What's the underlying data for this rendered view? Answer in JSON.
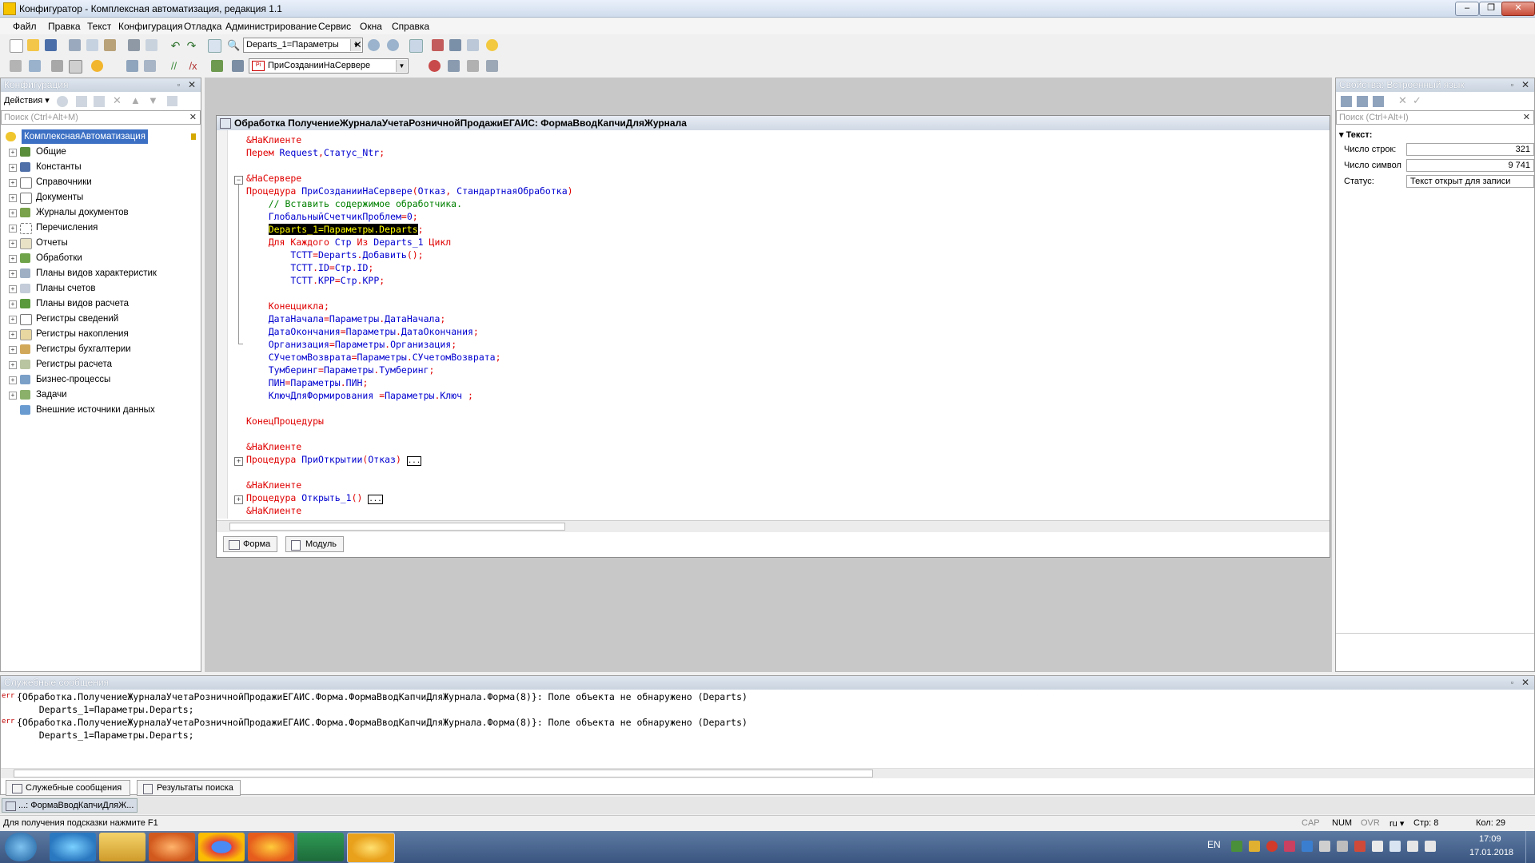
{
  "window": {
    "title": "Конфигуратор - Комплексная автоматизация, редакция 1.1"
  },
  "menu": [
    "Файл",
    "Правка",
    "Текст",
    "Конфигурация",
    "Отладка",
    "Администрирование",
    "Сервис",
    "Окна",
    "Справка"
  ],
  "toolbar": {
    "search_combo": "Departs_1=Параметры",
    "method_combo": "ПриСозданииНаСервере"
  },
  "config_panel": {
    "title": "Конфигурация",
    "actions_label": "Действия",
    "search_placeholder": "Поиск (Ctrl+Alt+M)",
    "root": "КомплекснаяАвтоматизация",
    "items": [
      "Общие",
      "Константы",
      "Справочники",
      "Документы",
      "Журналы документов",
      "Перечисления",
      "Отчеты",
      "Обработки",
      "Планы видов характеристик",
      "Планы счетов",
      "Планы видов расчета",
      "Регистры сведений",
      "Регистры накопления",
      "Регистры бухгалтерии",
      "Регистры расчета",
      "Бизнес-процессы",
      "Задачи",
      "Внешние источники данных"
    ]
  },
  "editor": {
    "title": "Обработка ПолучениеЖурналаУчетаРозничнойПродажиЕГАИС: ФормаВводКапчиДляЖурнала",
    "tabs": [
      "Форма",
      "Модуль"
    ]
  },
  "properties": {
    "title": "Свойства: Встроенный язык",
    "search_placeholder": "Поиск (Ctrl+Alt+I)",
    "section": "Текст:",
    "rows": [
      {
        "label": "Число строк:",
        "value": "321"
      },
      {
        "label": "Число символ",
        "value": "9 741"
      },
      {
        "label": "Статус:",
        "value": "Текст открыт для записи"
      }
    ]
  },
  "messages": {
    "title": "Служебные сообщения",
    "err_tag": "err",
    "lines": [
      "{Обработка.ПолучениеЖурналаУчетаРозничнойПродажиЕГАИС.Форма.ФормаВводКапчиДляЖурнала.Форма(8)}: Поле объекта не обнаружено (Departs)",
      "    Departs_1=Параметры.Departs;",
      "{Обработка.ПолучениеЖурналаУчетаРозничнойПродажиЕГАИС.Форма.ФормаВводКапчиДляЖурнала.Форма(8)}: Поле объекта не обнаружено (Departs)",
      "    Departs_1=Параметры.Departs;"
    ],
    "tabs": [
      "Служебные сообщения",
      "Результаты поиска"
    ]
  },
  "window_tab": "...: ФормаВводКапчиДляЖ...",
  "status": {
    "hint": "Для получения подсказки нажмите F1",
    "cap": "CAP",
    "num": "NUM",
    "ovr": "OVR",
    "lang": "ru",
    "line": "Стр: 8",
    "col": "Кол: 29"
  },
  "taskbar": {
    "lang": "EN",
    "time": "17:09",
    "date": "17.01.2018"
  },
  "icons": [
    "app-1c-icon",
    "new-icon",
    "open-icon",
    "save-icon",
    "cut-icon",
    "copy-icon",
    "paste-icon",
    "print-icon",
    "undo-icon",
    "redo-icon",
    "find-icon",
    "search-icon",
    "gear-icon",
    "start-orb-icon",
    "ie-icon",
    "explorer-icon",
    "media-icon",
    "chrome-icon",
    "firefox-icon",
    "excel-icon",
    "onec-icon"
  ]
}
